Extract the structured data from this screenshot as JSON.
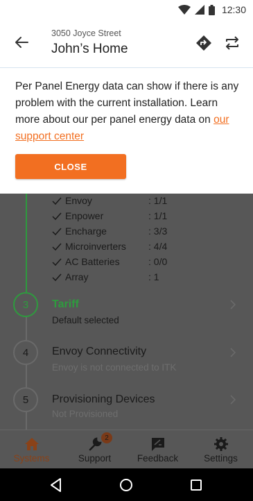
{
  "status_bar": {
    "time": "12:30",
    "icons": [
      "wifi-icon",
      "signal-icon",
      "battery-icon"
    ]
  },
  "header": {
    "address": "3050 Joyce Street",
    "title": "John’s Home",
    "icons": [
      "back-arrow-icon",
      "directions-icon",
      "swap-icon"
    ]
  },
  "info": {
    "text": "Per Panel Energy data can  show if there is any problem with the current installation. Learn more about our per panel energy data on ",
    "link_text": "our support center",
    "close_label": "CLOSE"
  },
  "devices": [
    {
      "name": "Envoy",
      "value": ": 1/1"
    },
    {
      "name": "Enpower",
      "value": ": 1/1"
    },
    {
      "name": "Encharge",
      "value": ": 3/3"
    },
    {
      "name": "Microinverters",
      "value": ": 4/4"
    },
    {
      "name": "AC Batteries",
      "value": ": 0/0"
    },
    {
      "name": "Array",
      "value": ": 1"
    }
  ],
  "steps": [
    {
      "number": "3",
      "title": "Tariff",
      "subtitle": "Default selected",
      "state": "complete"
    },
    {
      "number": "4",
      "title": "Envoy Connectivity",
      "subtitle": "Envoy is not connected to ITK",
      "state": "pending"
    },
    {
      "number": "5",
      "title": "Provisioning Devices",
      "subtitle": "Not Provisioned",
      "state": "pending"
    }
  ],
  "bottom_nav": [
    {
      "label": "Systems",
      "icon": "home-icon",
      "active": true
    },
    {
      "label": "Support",
      "icon": "wrench-icon",
      "badge": "2"
    },
    {
      "label": "Feedback",
      "icon": "feedback-icon"
    },
    {
      "label": "Settings",
      "icon": "gear-icon"
    }
  ],
  "system_nav": [
    "back-triangle-icon",
    "home-circle-icon",
    "recents-square-icon"
  ],
  "colors": {
    "accent": "#f26f21",
    "success": "#2e9b3e",
    "overlay": "#575757"
  }
}
